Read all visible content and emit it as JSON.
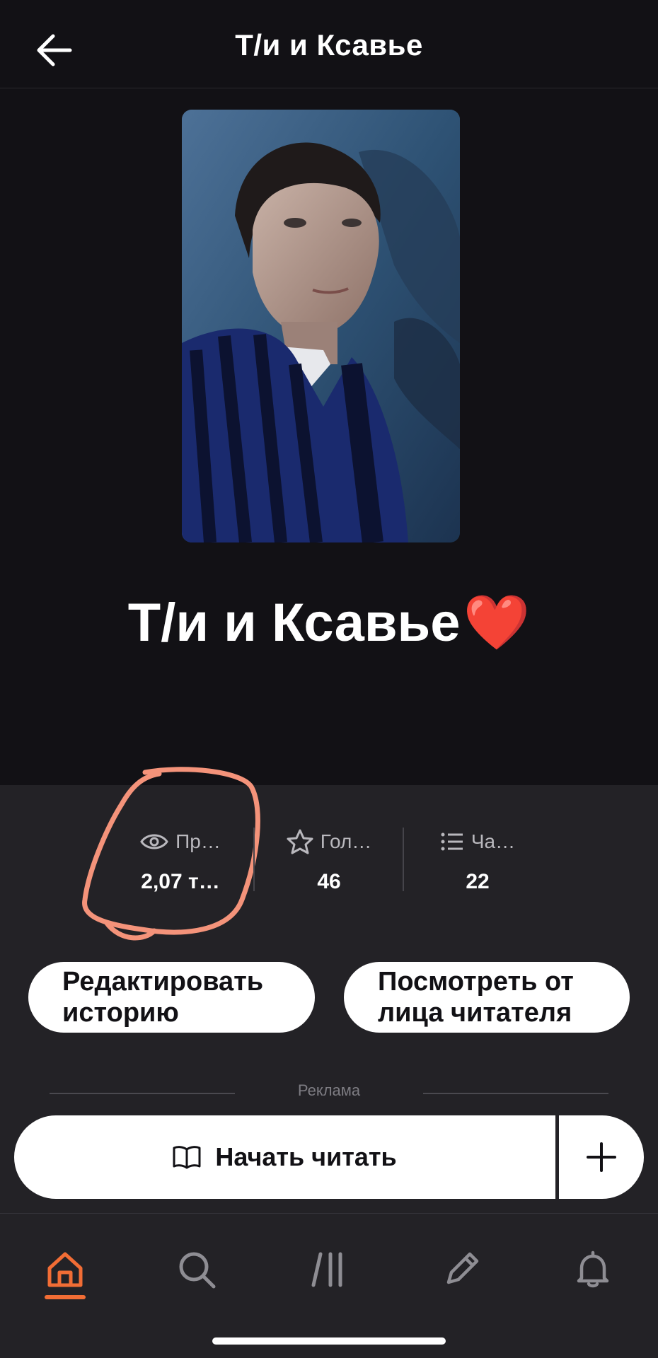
{
  "header": {
    "title": "Т/и и Ксавье"
  },
  "story": {
    "title": "Т/и и Ксавье",
    "title_emoji": "❤️"
  },
  "stats": [
    {
      "label": "Пр…",
      "value": "2,07 т…",
      "icon": "eye-icon"
    },
    {
      "label": "Гол…",
      "value": "46",
      "icon": "star-icon"
    },
    {
      "label": "Ча…",
      "value": "22",
      "icon": "list-icon"
    }
  ],
  "buttons": {
    "edit_line1": "Редактировать",
    "edit_line2": "историю",
    "reader_line1": "Посмотреть от",
    "reader_line2": "лица читателя"
  },
  "ad": {
    "label": "Реклама"
  },
  "read": {
    "label": "Начать читать"
  },
  "nav": {
    "items": [
      "home-icon",
      "search-icon",
      "library-icon",
      "write-icon",
      "bell-icon"
    ],
    "active": "home-icon"
  },
  "colors": {
    "accent": "#f26d35",
    "annotation": "#f4937a",
    "background": "#121115",
    "panel": "#232226"
  }
}
